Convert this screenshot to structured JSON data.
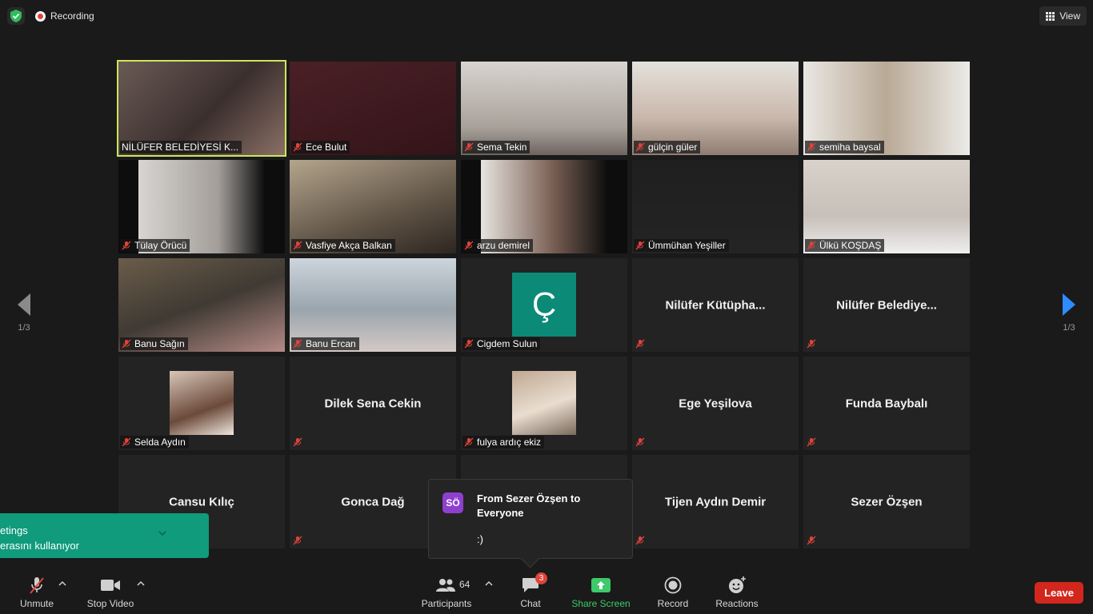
{
  "topbar": {
    "recording_label": "Recording",
    "view_label": "View",
    "shield_icon": "shield-check-icon",
    "colors": {
      "shield": "#2ebd59",
      "recording": "#e0433a"
    }
  },
  "tiles": [
    {
      "name": "NİLÜFER BELEDİYESİ K...",
      "video": true,
      "active": true,
      "mic_icon": "none"
    },
    {
      "name": "Ece Bulut",
      "video": true,
      "mic_icon": "mic-off-icon"
    },
    {
      "name": "Sema Tekin",
      "video": true,
      "mic_icon": "mic-off-icon"
    },
    {
      "name": "gülçin güler",
      "video": true,
      "mic_icon": "mic-off-icon"
    },
    {
      "name": "semiha baysal",
      "video": true,
      "mic_icon": "mic-off-icon"
    },
    {
      "name": "Tülay Örücü",
      "video": true,
      "mic_icon": "mic-off-icon"
    },
    {
      "name": "Vasfiye Akça Balkan",
      "video": true,
      "mic_icon": "mic-off-icon"
    },
    {
      "name": "arzu demirel",
      "video": true,
      "mic_icon": "mic-off-icon"
    },
    {
      "name": "Ümmühan Yeşiller",
      "video": true,
      "mic_icon": "mic-off-icon"
    },
    {
      "name": "Ülkü KOŞDAŞ",
      "video": true,
      "mic_icon": "mic-off-icon"
    },
    {
      "name": "Banu Sağın",
      "video": true,
      "mic_icon": "mic-off-icon"
    },
    {
      "name": "Banu Ercan",
      "video": true,
      "mic_icon": "mic-off-icon"
    },
    {
      "name": "Cigdem Sulun",
      "avatar_letter": "Ç",
      "mic_icon": "mic-off-icon"
    },
    {
      "center_name": "Nilüfer  Kütüpha...",
      "mic_icon": "mic-off-icon"
    },
    {
      "center_name": "Nilüfer  Belediye...",
      "mic_icon": "mic-off-icon"
    },
    {
      "name": "Selda Aydın",
      "avatar_photo": true,
      "mic_icon": "mic-off-icon"
    },
    {
      "center_name": "Dilek Sena Cekin",
      "mic_icon": "mic-off-icon"
    },
    {
      "name": "fulya ardıç ekiz",
      "avatar_photo": true,
      "mic_icon": "mic-off-icon"
    },
    {
      "center_name": "Ege Yeşilova",
      "mic_icon": "mic-off-icon"
    },
    {
      "center_name": "Funda Baybalı",
      "mic_icon": "mic-off-icon"
    },
    {
      "center_name": "Cansu Kılıç",
      "mic_icon": "mic-off-icon"
    },
    {
      "center_name": "Gonca Dağ",
      "mic_icon": "mic-off-icon"
    },
    {
      "center_name": "",
      "mic_icon": "none"
    },
    {
      "center_name": "Tijen Aydın Demir",
      "mic_icon": "mic-off-icon"
    },
    {
      "center_name": "Sezer Özşen",
      "mic_icon": "mic-off-icon"
    }
  ],
  "nav": {
    "left_page": "1/3",
    "right_page": "1/3",
    "left_icon": "prev-page-arrow-icon",
    "right_icon": "next-page-arrow-icon",
    "colors": {
      "right_arrow": "#2d8cff"
    }
  },
  "toast": {
    "line1": "etings",
    "line2": "erasını kullanıyor",
    "color": "#0f9b7c"
  },
  "chat_popup": {
    "avatar_initials": "SÖ",
    "title": "From Sezer Özşen to Everyone",
    "message": ":)",
    "avatar_color": "#8f3fd0"
  },
  "toolbar": {
    "unmute_label": "Unmute",
    "stop_video_label": "Stop Video",
    "participants_label": "Participants",
    "participants_count": "64",
    "chat_label": "Chat",
    "chat_badge": "3",
    "share_screen_label": "Share Screen",
    "record_label": "Record",
    "reactions_label": "Reactions",
    "leave_label": "Leave",
    "colors": {
      "share": "#3ec96b",
      "leave": "#d2271d",
      "badge": "#e0433a"
    }
  }
}
